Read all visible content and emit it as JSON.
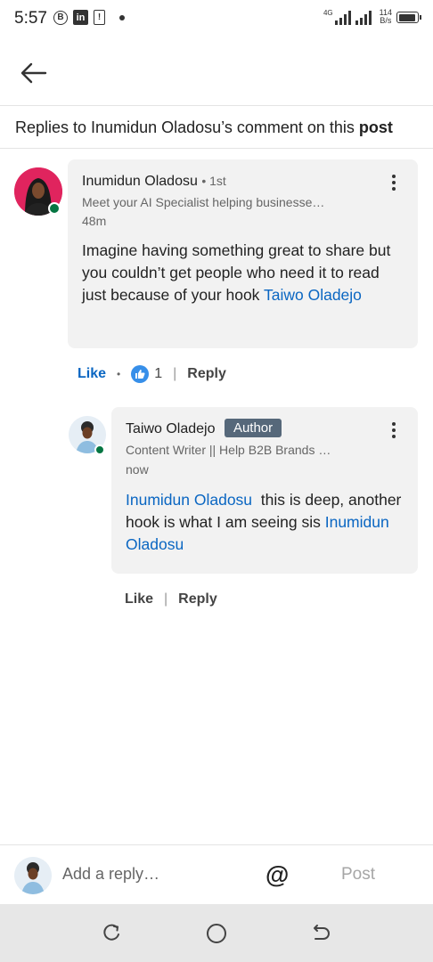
{
  "status_bar": {
    "time": "5:57",
    "b_icon_text": "B",
    "linkedin_icon_text": "in",
    "alert_icon_text": "!",
    "network": "4G",
    "speed_value": "114",
    "speed_unit": "B/s"
  },
  "header": {
    "prefix": "Replies to ",
    "author": "Inumidun Oladosu",
    "middle": "’s comment on this ",
    "suffix": "post"
  },
  "comment": {
    "name": "Inumidun Oladosu",
    "degree": "• 1st",
    "headline": "Meet your AI Specialist helping businesse…",
    "time": "48m",
    "text_before": "Imagine having something great to share but you couldn’t get people who need it to read just because of your hook ",
    "mention": "Taiwo Oladejo",
    "actions": {
      "like": "Like",
      "dot": "•",
      "reaction_count": "1",
      "separator": "|",
      "reply": "Reply"
    }
  },
  "reply": {
    "name": "Taiwo Oladejo",
    "badge": "Author",
    "headline": "Content Writer || Help B2B Brands …",
    "time": "now",
    "mention_1": "Inumidun Oladosu",
    "text_middle": "  this is deep, another hook is what I am seeing sis ",
    "mention_2": "Inumidun Oladosu",
    "actions": {
      "like": "Like",
      "separator": "|",
      "reply": "Reply"
    }
  },
  "compose": {
    "placeholder": "Add a reply…",
    "at_symbol": "@",
    "post_label": "Post"
  },
  "colors": {
    "link_blue": "#0a66c2",
    "online_green": "#057642",
    "author_badge": "#56687a",
    "bubble_bg": "#f2f2f2",
    "avatar_1_bg": "#e0245e"
  },
  "icons": {
    "back": "arrow-left-icon",
    "more": "more-vertical-icon",
    "reaction": "thumbs-up-reaction-icon",
    "mention": "at-sign-icon",
    "nav_recents": "recents-icon",
    "nav_home": "home-circle-icon",
    "nav_back": "nav-back-icon"
  }
}
